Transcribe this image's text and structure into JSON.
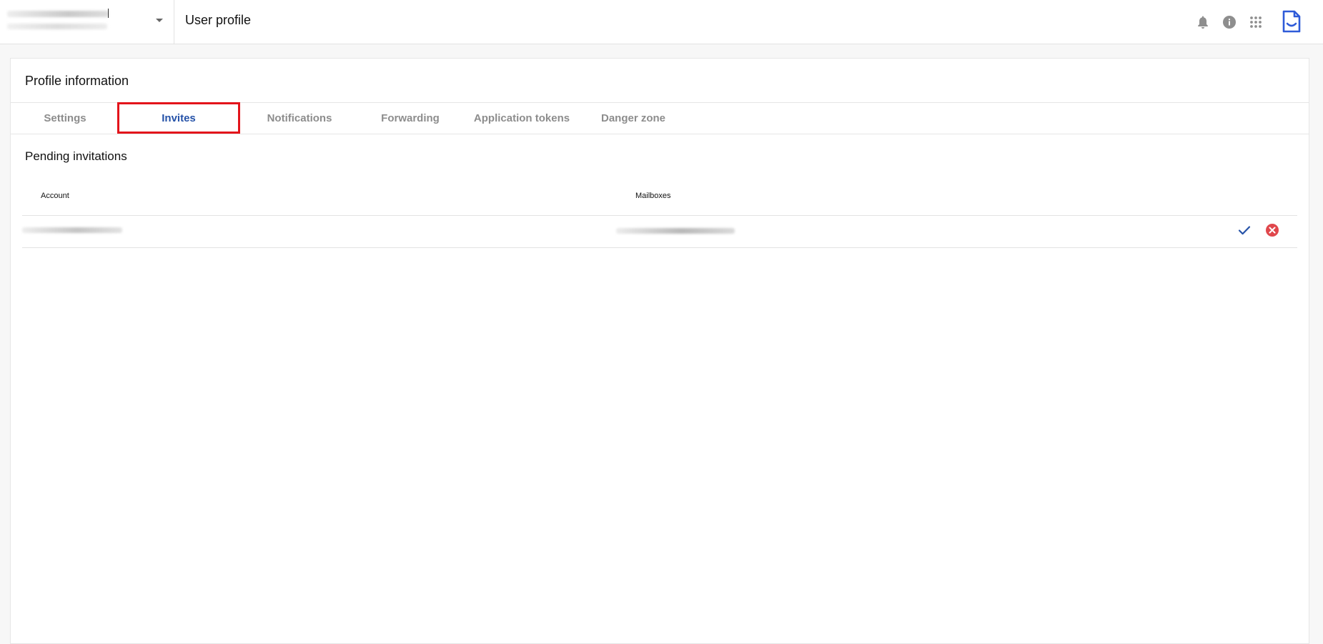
{
  "header": {
    "page_title": "User profile",
    "icons": [
      "bell-icon",
      "info-icon",
      "apps-grid-icon",
      "document-logo-icon"
    ]
  },
  "profile": {
    "title": "Profile information",
    "tabs": [
      {
        "label": "Settings",
        "active": false
      },
      {
        "label": "Invites",
        "active": true
      },
      {
        "label": "Notifications",
        "active": false
      },
      {
        "label": "Forwarding",
        "active": false
      },
      {
        "label": "Application tokens",
        "active": false
      },
      {
        "label": "Danger zone",
        "active": false
      }
    ]
  },
  "invites": {
    "section_title": "Pending invitations",
    "columns": [
      "Account",
      "Mailboxes"
    ],
    "row_actions": [
      "accept-check-icon",
      "decline-x-icon"
    ]
  },
  "colors": {
    "accent": "#2552a8",
    "highlight": "#e3141b",
    "decline": "#e0474c",
    "muted_text": "#8d8d8d"
  }
}
